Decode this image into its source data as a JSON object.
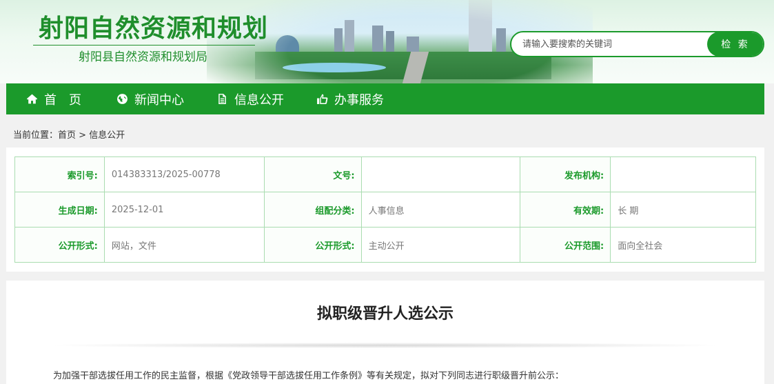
{
  "header": {
    "title": "射阳自然资源和规划",
    "subtitle": "射阳县自然资源和规划局",
    "search_placeholder": "请输入要搜索的关键词",
    "search_button": "检 索"
  },
  "nav": {
    "items": [
      {
        "label": "首　页",
        "icon": "home-icon"
      },
      {
        "label": "新闻中心",
        "icon": "globe-icon"
      },
      {
        "label": "信息公开",
        "icon": "document-icon"
      },
      {
        "label": "办事服务",
        "icon": "thumbs-up-icon"
      }
    ]
  },
  "breadcrumb": {
    "prefix": "当前位置：",
    "home": "首页",
    "separator": " > ",
    "current": "信息公开"
  },
  "meta": {
    "rows": [
      [
        {
          "key": "索引号:",
          "value": "014383313/2025-00778"
        },
        {
          "key": "文号:",
          "value": ""
        },
        {
          "key": "发布机构:",
          "value": ""
        }
      ],
      [
        {
          "key": "生成日期:",
          "value": "2025-12-01"
        },
        {
          "key": "组配分类:",
          "value": "人事信息"
        },
        {
          "key": "有效期:",
          "value": "长 期"
        }
      ],
      [
        {
          "key": "公开形式:",
          "value": "网站，文件"
        },
        {
          "key": "公开形式:",
          "value": "主动公开"
        },
        {
          "key": "公开范围:",
          "value": "面向全社会"
        }
      ]
    ]
  },
  "article": {
    "title": "拟职级晋升人选公示",
    "intro": "为加强干部选拔任用工作的民主监督，根据《党政领导干部选拔任用工作条例》等有关规定，拟对下列同志进行职级晋升前公示："
  },
  "colors": {
    "brand_green": "#1b9a2b",
    "title_green": "#1f8e2c",
    "table_border": "#a9dcb0"
  }
}
